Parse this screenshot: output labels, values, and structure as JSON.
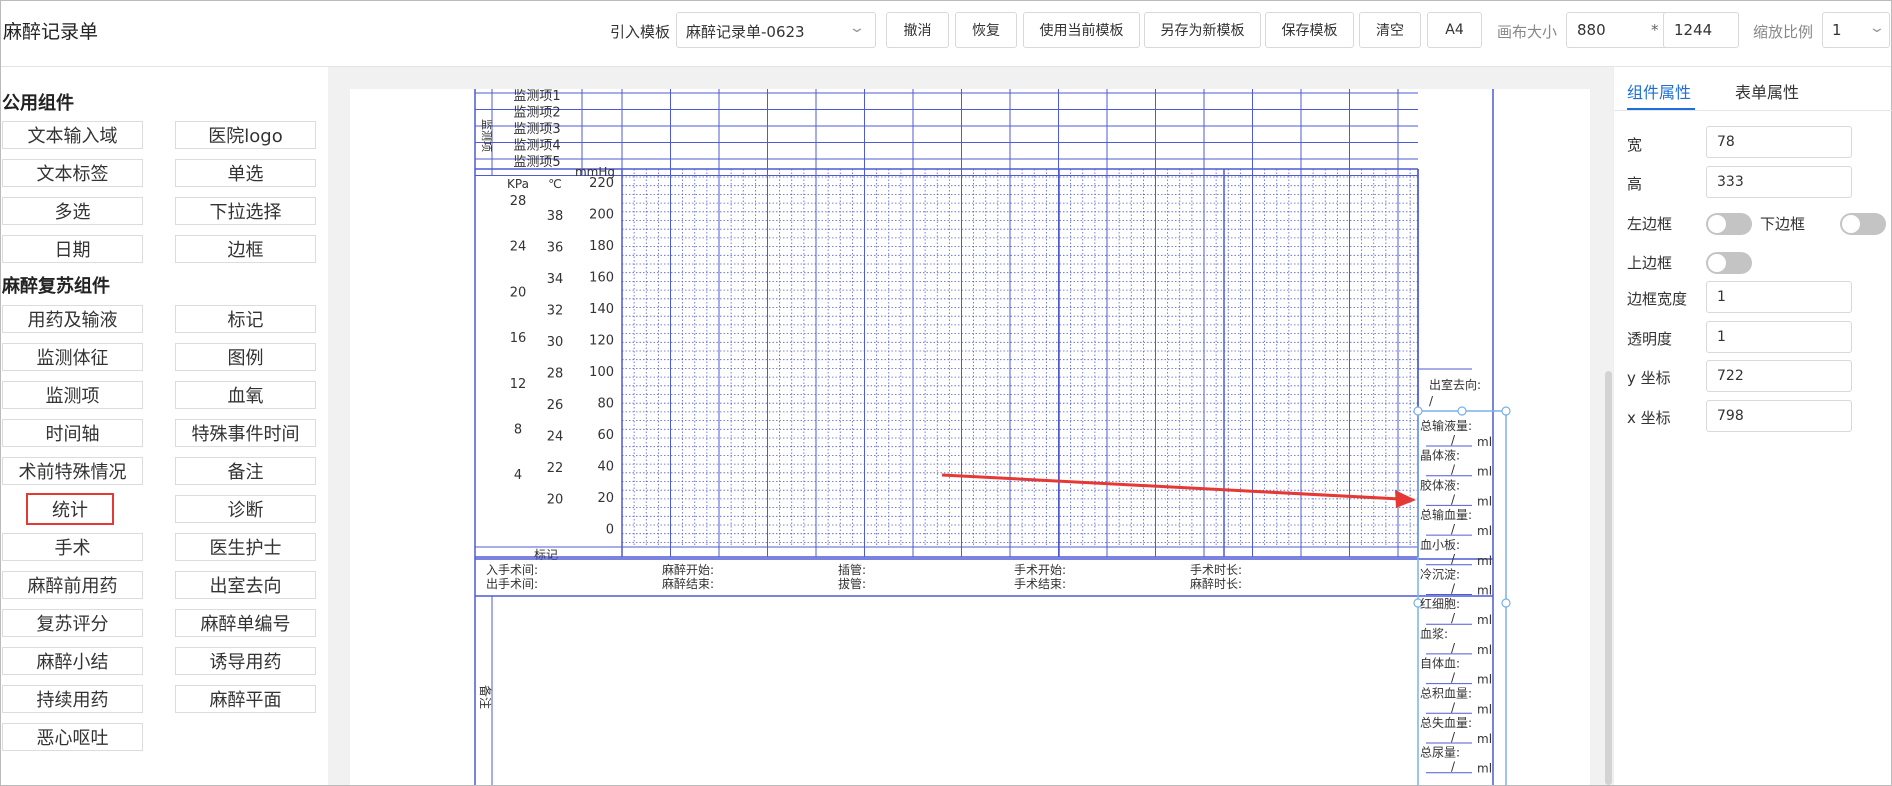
{
  "app": {
    "title": "麻醉记录单"
  },
  "toolbar": {
    "template_label": "引入模板",
    "template_value": "麻醉记录单-0623",
    "buttons": [
      "撤消",
      "恢复",
      "使用当前模板",
      "另存为新模板",
      "保存模板",
      "清空",
      "A4"
    ],
    "canvas_label": "画布大小",
    "canvas_width": "880",
    "times": "*",
    "canvas_height": "1244",
    "scale_label": "缩放比例",
    "scale_value": "1"
  },
  "left": {
    "public_title": "公用组件",
    "public_items": [
      "文本输入域",
      "医院logo",
      "文本标签",
      "单选",
      "多选",
      "下拉选择",
      "日期",
      "边框"
    ],
    "anes_title": "麻醉复苏组件",
    "anes_items": [
      "用药及输液",
      "标记",
      "监测体征",
      "图例",
      "监测项",
      "血氧",
      "时间轴",
      "特殊事件时间",
      "术前特殊情况",
      "备注",
      "统计",
      "诊断",
      "手术",
      "医生护士",
      "麻醉前用药",
      "出室去向",
      "复苏评分",
      "麻醉单编号",
      "麻醉小结",
      "诱导用药",
      "持续用药",
      "麻醉平面",
      "恶心呕吐"
    ],
    "selected_item": "统计"
  },
  "right": {
    "tabs": [
      "组件属性",
      "表单属性"
    ],
    "active_tab": "组件属性",
    "props": {
      "width_label": "宽",
      "width": "78",
      "height_label": "高",
      "height": "333",
      "left_border_label": "左边框",
      "bottom_border_label": "下边框",
      "top_border_label": "上边框",
      "border_width_label": "边框宽度",
      "border_width": "1",
      "opacity_label": "透明度",
      "opacity": "1",
      "y_label": "y 坐标",
      "y": "722",
      "x_label": "x 坐标",
      "x": "798"
    }
  },
  "form": {
    "monitor_side_label": "监测项",
    "monitor_items": [
      "监测项1",
      "监测项2",
      "监测项3",
      "监测项4",
      "监测项5"
    ],
    "axis_units": [
      "KPa",
      "℃",
      "mmHg"
    ],
    "kpa_ticks": [
      "28",
      "24",
      "20",
      "16",
      "12",
      "8",
      "4"
    ],
    "temp_ticks": [
      "38",
      "36",
      "34",
      "32",
      "30",
      "28",
      "26",
      "24",
      "22",
      "20"
    ],
    "mmhg_ticks": [
      "220",
      "200",
      "180",
      "160",
      "140",
      "120",
      "100",
      "80",
      "60",
      "40",
      "20",
      "0"
    ],
    "mark_label": "标记",
    "times_row1": [
      "入手术间:",
      "麻醉开始:",
      "插管:",
      "手术开始:",
      "手术时长:"
    ],
    "times_row2": [
      "出手术间:",
      "麻醉结束:",
      "拔管:",
      "手术结束:",
      "麻醉时长:"
    ],
    "remark_label": "备注",
    "exit_label": "出室去向:",
    "slash": "/",
    "stats": [
      {
        "label": "总输液量:",
        "unit": "ml"
      },
      {
        "label": "晶体液:",
        "unit": "ml"
      },
      {
        "label": "胶体液:",
        "unit": "ml"
      },
      {
        "label": "总输血量:",
        "unit": "ml"
      },
      {
        "label": "血小板:",
        "unit": "ml"
      },
      {
        "label": "冷沉淀:",
        "unit": "ml"
      },
      {
        "label": "红细胞:",
        "unit": "ml"
      },
      {
        "label": "血浆:",
        "unit": "ml"
      },
      {
        "label": "自体血:",
        "unit": "ml"
      },
      {
        "label": "总积血量:",
        "unit": "ml"
      },
      {
        "label": "总失血量:",
        "unit": "ml"
      },
      {
        "label": "总尿量:",
        "unit": "ml"
      }
    ]
  },
  "colors": {
    "accent": "#1e6fd9",
    "grid": "#4f5bd5",
    "arrow": "#e53935",
    "selection": "#7ab0e8"
  }
}
